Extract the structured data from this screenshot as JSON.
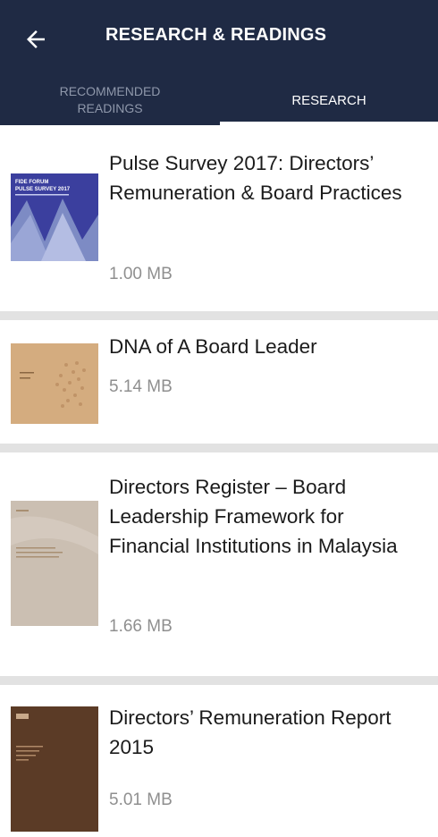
{
  "app_bar": {
    "title": "RESEARCH & READINGS",
    "back_icon": "arrow-left-icon"
  },
  "tabs": [
    {
      "label": "RECOMMENDED READINGS",
      "selected": false
    },
    {
      "label": "RESEARCH",
      "selected": true
    }
  ],
  "items": [
    {
      "title": "Pulse Survey 2017: Directors’ Remuneration & Board Practices",
      "size": "1.00 MB",
      "cover": {
        "color": "#3b3f9e",
        "text": "FIDE FORUM PULSE SURVEY 2017"
      }
    },
    {
      "title": "DNA of A Board Leader",
      "size": "5.14 MB",
      "cover": {
        "color": "#d4ac7f"
      }
    },
    {
      "title": "Directors Register – Board Leadership Framework for Financial Institutions in Malaysia",
      "size": "1.66 MB",
      "cover": {
        "color": "#cbbfb2"
      }
    },
    {
      "title": "Directors’ Remuneration Report 2015",
      "size": "5.01 MB",
      "cover": {
        "color": "#5b3b26"
      }
    }
  ],
  "colors": {
    "app_bar": "#1f2a44",
    "separator": "#e2e2e2",
    "size_text": "#8f8f8f"
  }
}
